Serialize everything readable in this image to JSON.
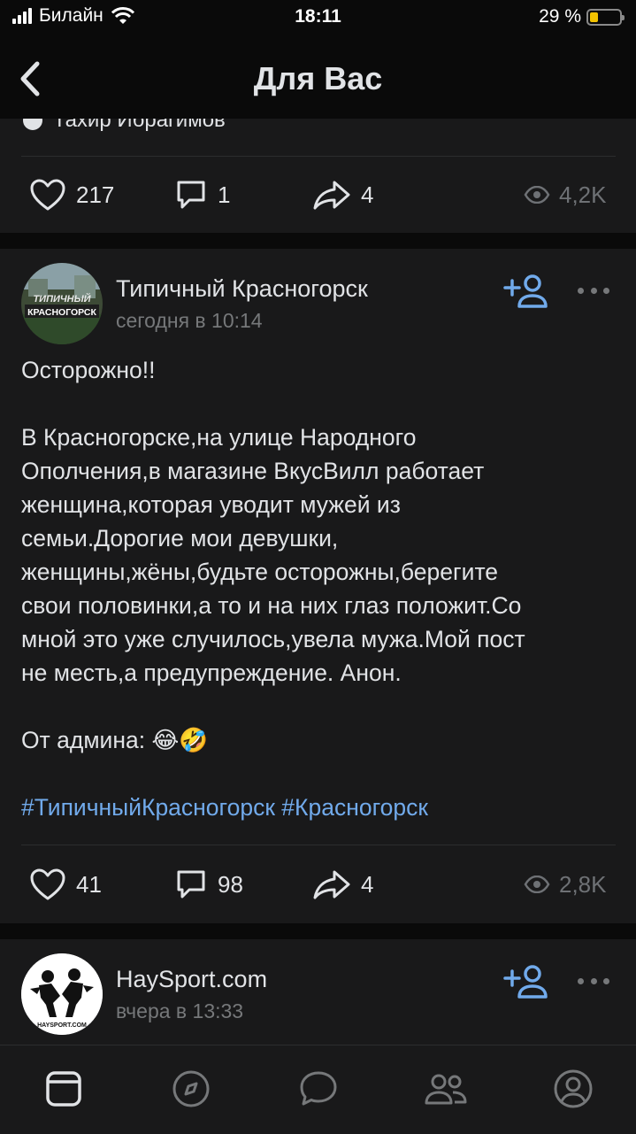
{
  "status_bar": {
    "carrier": "Билайн",
    "time": "18:11",
    "battery_percent": "29 %",
    "battery_level": 0.29
  },
  "nav": {
    "title": "Для Вас"
  },
  "post1": {
    "author_partial": "Тахир Ибрагимов",
    "likes": "217",
    "comments": "1",
    "shares": "4",
    "views": "4,2K"
  },
  "post2": {
    "author": "Типичный Красногорск",
    "time": "сегодня в 10:14",
    "avatar_text_top": "ТИПИЧНЫЙ",
    "avatar_text_bottom": "КРАСНОГОРСК",
    "text_lines": [
      "Осторожно!!",
      "",
      "В Красногорске,на улице Народного",
      "Ополчения,в магазине ВкусВилл работает",
      "женщина,которая уводит мужей из",
      "семьи.Дорогие мои девушки,",
      "женщины,жёны,будьте осторожны,берегите",
      "свои половинки,а то и на них глаз положит.Со",
      "мной это уже случилось,увела мужа.Мой пост",
      "не месть,а предупреждение. Анон.",
      "",
      "От админа: 😂🤣",
      "",
      "#ТипичныйКрасногорск #Красногорск"
    ],
    "likes": "41",
    "comments": "98",
    "shares": "4",
    "views": "2,8K"
  },
  "post3": {
    "author": "HaySport.com",
    "time": "вчера в 13:33",
    "avatar_text": "HAYSPORT.COM"
  },
  "colors": {
    "background": "#0a0a0a",
    "card": "#19191a",
    "text": "#e1e3e6",
    "secondary": "#76787a",
    "accent": "#71aaeb",
    "battery": "#f2c200"
  },
  "tabs": [
    "feed-icon",
    "discover-icon",
    "messages-icon",
    "friends-icon",
    "profile-icon"
  ]
}
